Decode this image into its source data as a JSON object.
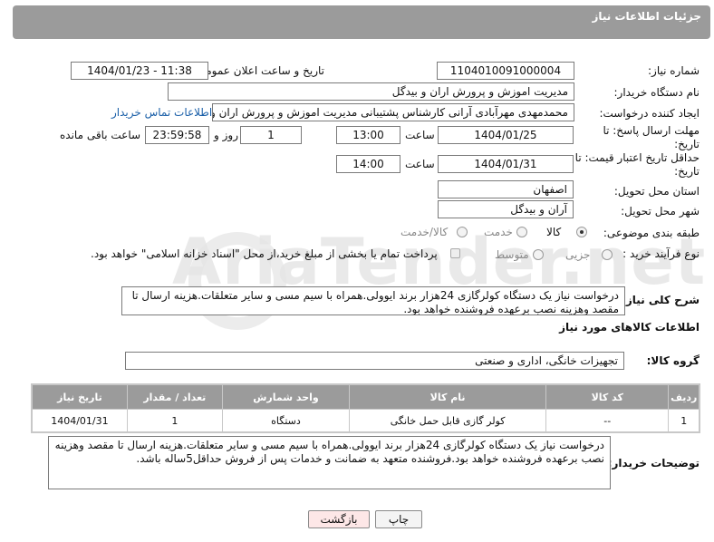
{
  "header": {
    "title": "جزئیات اطلاعات نیاز"
  },
  "watermark": "AriaTender.net",
  "fields": {
    "need_number_label": "شماره نیاز:",
    "need_number": "1104010091000004",
    "announce_label": "تاریخ و ساعت اعلان عمومی:",
    "announce_value": "1404/01/23 - 11:38",
    "buyer_label": "نام دستگاه خریدار:",
    "buyer_value": "مدیریت اموزش و پرورش اران و بیدگل",
    "creator_label": "ایجاد کننده درخواست:",
    "creator_value": "محمدمهدی مهرآبادی آرانی کارشناس پشتیبانی مدیریت اموزش و پرورش اران و بیدگل",
    "contact_link": "اطلاعات تماس خریدار",
    "deadline_label": "مهلت ارسال پاسخ: تا تاریخ:",
    "deadline_date": "1404/01/25",
    "time_label": "ساعت",
    "deadline_time": "13:00",
    "days_value": "1",
    "days_label": "روز و",
    "remaining_value": "23:59:58",
    "remaining_label": "ساعت باقی مانده",
    "validity_label": "حداقل تاریخ اعتبار قیمت: تا تاریخ:",
    "validity_date": "1404/01/31",
    "validity_time_label": "ساعت",
    "validity_time": "14:00",
    "province_label": "استان محل تحویل:",
    "province_value": "اصفهان",
    "city_label": "شهر محل تحویل:",
    "city_value": "آران و بیدگل",
    "category_label": "طبقه بندی موضوعی:",
    "category_options": [
      "کالا",
      "خدمت",
      "کالا/خدمت"
    ],
    "process_label": "نوع فرآیند خرید :",
    "process_options": [
      "جزیی",
      "متوسط"
    ],
    "payment_note": "پرداخت تمام یا بخشی از مبلغ خرید،از محل \"اسناد خزانه اسلامی\" خواهد بود."
  },
  "description": {
    "label": "شرح کلی نیاز:",
    "text": "درخواست نیاز یک دستگاه کولرگازی 24هزار برند ایوولی.همراه با سیم مسی و سایر متعلقات.هزینه ارسال تا مقصد وهزینه نصب برعهده فروشنده خواهد بود."
  },
  "goods_section": {
    "title": "اطلاعات کالاهای مورد نیاز",
    "group_label": "گروه کالا:",
    "group_value": "تجهیزات خانگی، اداری و صنعتی"
  },
  "table": {
    "headers": [
      "ردیف",
      "کد کالا",
      "نام کالا",
      "واحد شمارش",
      "تعداد / مقدار",
      "تاریخ نیاز"
    ],
    "rows": [
      {
        "row": "1",
        "code": "--",
        "name": "کولر گازی قابل حمل خانگی",
        "unit": "دستگاه",
        "qty": "1",
        "date": "1404/01/31"
      }
    ]
  },
  "buyer_notes": {
    "label": "توضیحات خریدار:",
    "text": "درخواست نیاز یک دستگاه کولرگازی 24هزار برند ایوولی.همراه با سیم مسی و سایر متعلقات.هزینه ارسال تا مقصد وهزینه نصب برعهده فروشنده خواهد بود.فروشنده متعهد به ضمانت و خدمات پس از فروش حداقل5ساله باشد."
  },
  "buttons": {
    "print": "چاپ",
    "back": "بازگشت"
  }
}
